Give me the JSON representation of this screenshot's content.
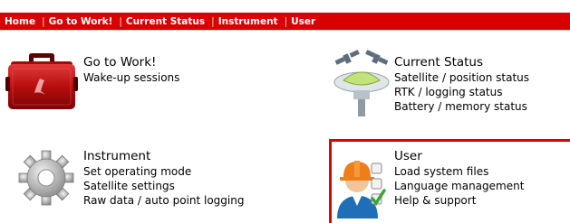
{
  "nav": {
    "items": [
      {
        "label": "Home"
      },
      {
        "label": "Go to Work!"
      },
      {
        "label": "Current Status"
      },
      {
        "label": "Instrument"
      },
      {
        "label": "User"
      }
    ],
    "separator": "|"
  },
  "tiles": {
    "go_to_work": {
      "title": "Go to Work!",
      "lines": [
        "Wake-up sessions"
      ],
      "icon": "red-instrument-case-icon"
    },
    "current_status": {
      "title": "Current Status",
      "lines": [
        "Satellite / position status",
        "RTK / logging status",
        "Battery / memory status"
      ],
      "icon": "gnss-antenna-satellites-icon"
    },
    "instrument": {
      "title": "Instrument",
      "lines": [
        "Set operating mode",
        "Satellite settings",
        "Raw data / auto point logging"
      ],
      "icon": "gear-icon"
    },
    "user": {
      "title": "User",
      "lines": [
        "Load system files",
        "Language management",
        "Help & support"
      ],
      "icon": "user-hardhat-checklist-icon",
      "selected": true
    }
  },
  "colors": {
    "accent": "#d80000",
    "highlight_border": "#e00000"
  }
}
